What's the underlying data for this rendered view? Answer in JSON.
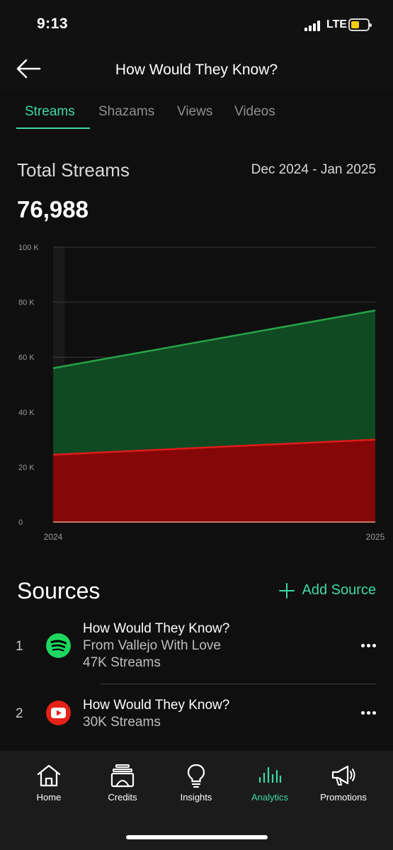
{
  "status_bar": {
    "time": "9:13",
    "network": "LTE",
    "battery_color": "#f2cc12"
  },
  "header": {
    "title": "How Would They Know?",
    "back_icon": "back-arrow-icon"
  },
  "tabs": [
    {
      "label": "Streams",
      "active": true
    },
    {
      "label": "Shazams",
      "active": false
    },
    {
      "label": "Views",
      "active": false
    },
    {
      "label": "Videos",
      "active": false
    }
  ],
  "summary": {
    "label": "Total Streams",
    "date_range": "Dec 2024 - Jan 2025",
    "total": "76,988"
  },
  "chart_data": {
    "type": "area",
    "x": [
      "2024",
      "2025"
    ],
    "y_ticks": [
      "0",
      "20 K",
      "40 K",
      "60 K",
      "80 K",
      "100 K"
    ],
    "ylim": [
      0,
      100000
    ],
    "grid": true,
    "stacked": false,
    "series": [
      {
        "values": [
          56000,
          77000
        ],
        "color": "#27a34a",
        "fill": "#0f4a22"
      },
      {
        "values": [
          24500,
          30000
        ],
        "color": "#e01b1b",
        "fill": "#850707"
      }
    ]
  },
  "sources": {
    "title": "Sources",
    "add_label": "Add Source",
    "items": [
      {
        "index": "1",
        "icon": "spotify-icon",
        "title": "How Would They Know?",
        "subtitle": "From Vallejo With Love",
        "streams": "47K Streams"
      },
      {
        "index": "2",
        "icon": "youtube-icon",
        "title": "How Would They Know?",
        "streams": "30K Streams"
      }
    ]
  },
  "bottom_nav": [
    {
      "label": "Home",
      "icon": "home-icon"
    },
    {
      "label": "Credits",
      "icon": "credits-icon"
    },
    {
      "label": "Insights",
      "icon": "lightbulb-icon"
    },
    {
      "label": "Analytics",
      "icon": "analytics-icon",
      "active": true
    },
    {
      "label": "Promotions",
      "icon": "megaphone-icon"
    }
  ],
  "colors": {
    "accent": "#3fd9a3",
    "background": "#0f0f0f",
    "spotify": "#1ed760",
    "youtube": "#e62117"
  }
}
